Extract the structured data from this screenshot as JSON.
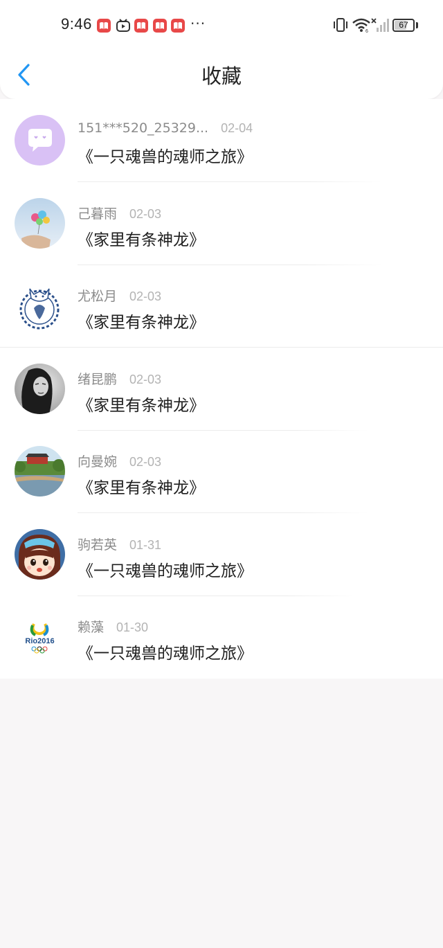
{
  "status_bar": {
    "time": "9:46",
    "more": "···",
    "battery": "67",
    "battery_level": 0.67
  },
  "header": {
    "title": "收藏",
    "back_icon": "chevron-left-icon"
  },
  "items": [
    {
      "user": "151***520_25329...",
      "date": "02-04",
      "book": "《一只魂兽的魂师之旅》",
      "avatar": "chat-bubble-avatar"
    },
    {
      "user": "己暮雨",
      "date": "02-03",
      "book": "《家里有条神龙》",
      "avatar": "balloons-photo-avatar"
    },
    {
      "user": "尤松月",
      "date": "02-03",
      "book": "《家里有条神龙》",
      "avatar": "porcelain-mascot-avatar"
    },
    {
      "user": "绪昆鹏",
      "date": "02-03",
      "book": "《家里有条神龙》",
      "avatar": "portrait-photo-avatar"
    },
    {
      "user": "向曼婉",
      "date": "02-03",
      "book": "《家里有条神龙》",
      "avatar": "garden-photo-avatar"
    },
    {
      "user": "驹若英",
      "date": "01-31",
      "book": "《一只魂兽的魂师之旅》",
      "avatar": "cartoon-girl-avatar"
    },
    {
      "user": "赖藻",
      "date": "01-30",
      "book": "《一只魂兽的魂师之旅》",
      "avatar": "rio2016-logo-avatar"
    }
  ],
  "colors": {
    "accent": "#2196f3",
    "page_bg": "#f8f6f7",
    "username": "#8b8b8b",
    "date": "#b3b3b3",
    "title_text": "#1f1f1f"
  }
}
